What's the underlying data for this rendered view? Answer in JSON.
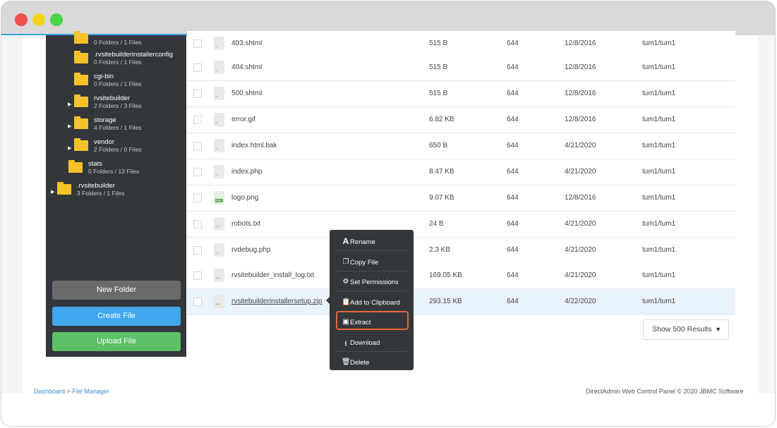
{
  "window": {
    "controls": [
      "close",
      "minimize",
      "maximize"
    ]
  },
  "sidebar": {
    "tree": [
      {
        "name": "",
        "meta": "0 Folders / 1 Files",
        "expandable": false,
        "indent": 2
      },
      {
        "name": ".rvsitebuilderinstallerconfig",
        "meta": "0 Folders / 1 Files",
        "expandable": false,
        "indent": 2
      },
      {
        "name": "cgi-bin",
        "meta": "0 Folders / 1 Files",
        "expandable": false,
        "indent": 2
      },
      {
        "name": "rvsitebuilder",
        "meta": "2 Folders / 3 Files",
        "expandable": true,
        "indent": 2
      },
      {
        "name": "storage",
        "meta": "4 Folders / 1 Files",
        "expandable": true,
        "indent": 2
      },
      {
        "name": "vendor",
        "meta": "2 Folders / 0 Files",
        "expandable": true,
        "indent": 2
      },
      {
        "name": "stats",
        "meta": "0 Folders / 13 Files",
        "expandable": false,
        "indent": 1
      },
      {
        "name": ".rvsitebuilder",
        "meta": "3 Folders / 1 Files",
        "expandable": true,
        "indent": 0
      }
    ],
    "buttons": {
      "new_folder": "New Folder",
      "create_file": "Create File",
      "upload_file": "Upload File"
    }
  },
  "files": [
    {
      "name": "403.shtml",
      "size": "515 B",
      "perm": "644",
      "date": "12/8/2016",
      "owner": "tum1/tum1",
      "icon": "file-icon"
    },
    {
      "name": "404.shtml",
      "size": "515 B",
      "perm": "644",
      "date": "12/8/2016",
      "owner": "tum1/tum1",
      "icon": "file-icon"
    },
    {
      "name": "500.shtml",
      "size": "515 B",
      "perm": "644",
      "date": "12/8/2016",
      "owner": "tum1/tum1",
      "icon": "file-icon"
    },
    {
      "name": "error.gif",
      "size": "6.82 KB",
      "perm": "644",
      "date": "12/8/2016",
      "owner": "tum1/tum1",
      "icon": "file-icon"
    },
    {
      "name": "index.html.bak",
      "size": "650 B",
      "perm": "644",
      "date": "4/21/2020",
      "owner": "tum1/tum1",
      "icon": "file-icon"
    },
    {
      "name": "index.php",
      "size": "8.47 KB",
      "perm": "644",
      "date": "4/21/2020",
      "owner": "tum1/tum1",
      "icon": "file-icon"
    },
    {
      "name": "logo.png",
      "size": "9.07 KB",
      "perm": "644",
      "date": "12/8/2016",
      "owner": "tum1/tum1",
      "icon": "image-file-icon"
    },
    {
      "name": "robots.txt",
      "size": "24 B",
      "perm": "644",
      "date": "4/21/2020",
      "owner": "tum1/tum1",
      "icon": "text-file-icon"
    },
    {
      "name": "rvdebug.php",
      "size": "2.3 KB",
      "perm": "644",
      "date": "4/21/2020",
      "owner": "tum1/tum1",
      "icon": "file-icon"
    },
    {
      "name": "rvsitebuilder_install_log.txt",
      "size": "169.05 KB",
      "perm": "644",
      "date": "4/21/2020",
      "owner": "tum1/tum1",
      "icon": "text-file-icon"
    },
    {
      "name": "rvsitebuilderinstallersetup.zip",
      "size": "293.15 KB",
      "perm": "644",
      "date": "4/22/2020",
      "owner": "tum1/tum1",
      "icon": "zip-file-icon",
      "selected": true
    }
  ],
  "results_select": {
    "value": "Show 500 Results"
  },
  "context_menu": {
    "items": [
      {
        "id": "rename",
        "label": "Rename",
        "icon": "rename-icon"
      },
      {
        "id": "copy",
        "label": "Copy File",
        "icon": "copy-icon"
      },
      {
        "id": "permissions",
        "label": "Set Permissions",
        "icon": "gear-icon"
      },
      {
        "id": "clipboard",
        "label": "Add to Clipboard",
        "icon": "clipboard-icon"
      },
      {
        "id": "extract",
        "label": "Extract",
        "icon": "archive-icon",
        "highlighted": true
      },
      {
        "id": "download",
        "label": "Download",
        "icon": "download-icon"
      },
      {
        "id": "delete",
        "label": "Delete",
        "icon": "trash-icon"
      }
    ]
  },
  "footer": {
    "breadcrumb": {
      "home": "Dashboard",
      "separator": ">",
      "current": "File Manager"
    },
    "copyright": "DirectAdmin Web Control Panel © 2020 JBMC Software"
  },
  "colors": {
    "sidebar_bg": "#33373b",
    "accent_blue": "#3fa7ee",
    "accent_green": "#5cc066",
    "highlight_orange": "#e8683a",
    "folder_yellow": "#f5c22a"
  }
}
